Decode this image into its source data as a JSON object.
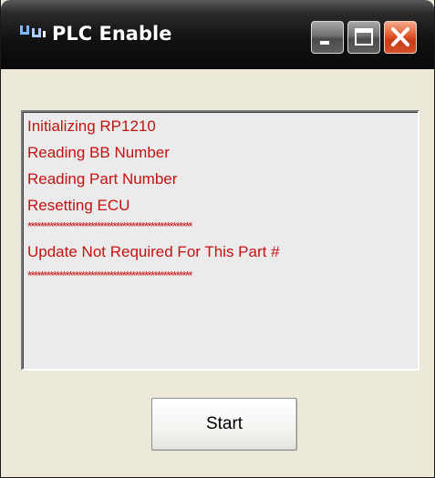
{
  "window": {
    "title": "PLC Enable",
    "icon": "plc-network-icon",
    "controls": [
      "minimize-icon",
      "maximize-icon",
      "close-icon"
    ]
  },
  "log": {
    "lines": [
      "Initializing RP1210",
      "Reading BB Number",
      "Reading Part Number",
      "Resetting ECU",
      "****************************************************",
      "Update Not Required For This Part #",
      "****************************************************"
    ],
    "text_color": "#c71010"
  },
  "actions": {
    "start_label": "Start"
  }
}
